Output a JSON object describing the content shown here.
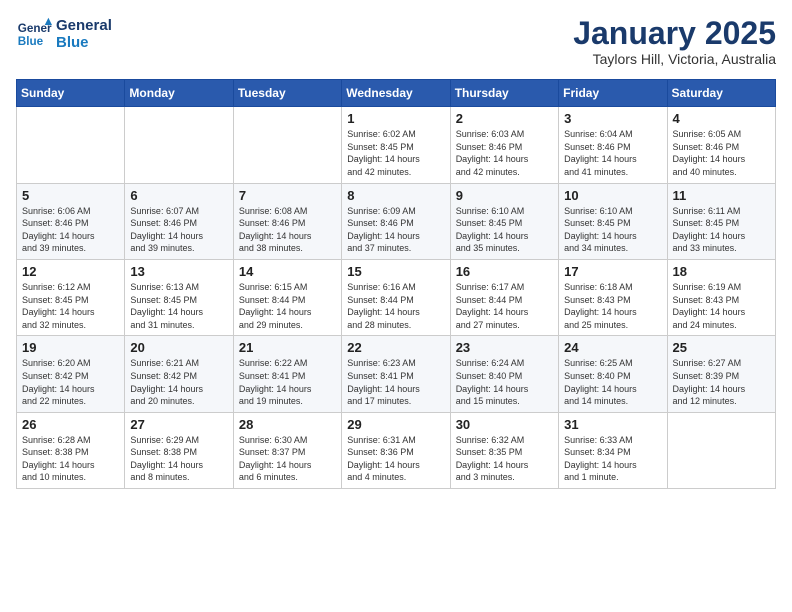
{
  "header": {
    "logo_line1": "General",
    "logo_line2": "Blue",
    "month": "January 2025",
    "location": "Taylors Hill, Victoria, Australia"
  },
  "days_of_week": [
    "Sunday",
    "Monday",
    "Tuesday",
    "Wednesday",
    "Thursday",
    "Friday",
    "Saturday"
  ],
  "weeks": [
    [
      {
        "day": "",
        "info": ""
      },
      {
        "day": "",
        "info": ""
      },
      {
        "day": "",
        "info": ""
      },
      {
        "day": "1",
        "info": "Sunrise: 6:02 AM\nSunset: 8:45 PM\nDaylight: 14 hours\nand 42 minutes."
      },
      {
        "day": "2",
        "info": "Sunrise: 6:03 AM\nSunset: 8:46 PM\nDaylight: 14 hours\nand 42 minutes."
      },
      {
        "day": "3",
        "info": "Sunrise: 6:04 AM\nSunset: 8:46 PM\nDaylight: 14 hours\nand 41 minutes."
      },
      {
        "day": "4",
        "info": "Sunrise: 6:05 AM\nSunset: 8:46 PM\nDaylight: 14 hours\nand 40 minutes."
      }
    ],
    [
      {
        "day": "5",
        "info": "Sunrise: 6:06 AM\nSunset: 8:46 PM\nDaylight: 14 hours\nand 39 minutes."
      },
      {
        "day": "6",
        "info": "Sunrise: 6:07 AM\nSunset: 8:46 PM\nDaylight: 14 hours\nand 39 minutes."
      },
      {
        "day": "7",
        "info": "Sunrise: 6:08 AM\nSunset: 8:46 PM\nDaylight: 14 hours\nand 38 minutes."
      },
      {
        "day": "8",
        "info": "Sunrise: 6:09 AM\nSunset: 8:46 PM\nDaylight: 14 hours\nand 37 minutes."
      },
      {
        "day": "9",
        "info": "Sunrise: 6:10 AM\nSunset: 8:45 PM\nDaylight: 14 hours\nand 35 minutes."
      },
      {
        "day": "10",
        "info": "Sunrise: 6:10 AM\nSunset: 8:45 PM\nDaylight: 14 hours\nand 34 minutes."
      },
      {
        "day": "11",
        "info": "Sunrise: 6:11 AM\nSunset: 8:45 PM\nDaylight: 14 hours\nand 33 minutes."
      }
    ],
    [
      {
        "day": "12",
        "info": "Sunrise: 6:12 AM\nSunset: 8:45 PM\nDaylight: 14 hours\nand 32 minutes."
      },
      {
        "day": "13",
        "info": "Sunrise: 6:13 AM\nSunset: 8:45 PM\nDaylight: 14 hours\nand 31 minutes."
      },
      {
        "day": "14",
        "info": "Sunrise: 6:15 AM\nSunset: 8:44 PM\nDaylight: 14 hours\nand 29 minutes."
      },
      {
        "day": "15",
        "info": "Sunrise: 6:16 AM\nSunset: 8:44 PM\nDaylight: 14 hours\nand 28 minutes."
      },
      {
        "day": "16",
        "info": "Sunrise: 6:17 AM\nSunset: 8:44 PM\nDaylight: 14 hours\nand 27 minutes."
      },
      {
        "day": "17",
        "info": "Sunrise: 6:18 AM\nSunset: 8:43 PM\nDaylight: 14 hours\nand 25 minutes."
      },
      {
        "day": "18",
        "info": "Sunrise: 6:19 AM\nSunset: 8:43 PM\nDaylight: 14 hours\nand 24 minutes."
      }
    ],
    [
      {
        "day": "19",
        "info": "Sunrise: 6:20 AM\nSunset: 8:42 PM\nDaylight: 14 hours\nand 22 minutes."
      },
      {
        "day": "20",
        "info": "Sunrise: 6:21 AM\nSunset: 8:42 PM\nDaylight: 14 hours\nand 20 minutes."
      },
      {
        "day": "21",
        "info": "Sunrise: 6:22 AM\nSunset: 8:41 PM\nDaylight: 14 hours\nand 19 minutes."
      },
      {
        "day": "22",
        "info": "Sunrise: 6:23 AM\nSunset: 8:41 PM\nDaylight: 14 hours\nand 17 minutes."
      },
      {
        "day": "23",
        "info": "Sunrise: 6:24 AM\nSunset: 8:40 PM\nDaylight: 14 hours\nand 15 minutes."
      },
      {
        "day": "24",
        "info": "Sunrise: 6:25 AM\nSunset: 8:40 PM\nDaylight: 14 hours\nand 14 minutes."
      },
      {
        "day": "25",
        "info": "Sunrise: 6:27 AM\nSunset: 8:39 PM\nDaylight: 14 hours\nand 12 minutes."
      }
    ],
    [
      {
        "day": "26",
        "info": "Sunrise: 6:28 AM\nSunset: 8:38 PM\nDaylight: 14 hours\nand 10 minutes."
      },
      {
        "day": "27",
        "info": "Sunrise: 6:29 AM\nSunset: 8:38 PM\nDaylight: 14 hours\nand 8 minutes."
      },
      {
        "day": "28",
        "info": "Sunrise: 6:30 AM\nSunset: 8:37 PM\nDaylight: 14 hours\nand 6 minutes."
      },
      {
        "day": "29",
        "info": "Sunrise: 6:31 AM\nSunset: 8:36 PM\nDaylight: 14 hours\nand 4 minutes."
      },
      {
        "day": "30",
        "info": "Sunrise: 6:32 AM\nSunset: 8:35 PM\nDaylight: 14 hours\nand 3 minutes."
      },
      {
        "day": "31",
        "info": "Sunrise: 6:33 AM\nSunset: 8:34 PM\nDaylight: 14 hours\nand 1 minute."
      },
      {
        "day": "",
        "info": ""
      }
    ]
  ]
}
